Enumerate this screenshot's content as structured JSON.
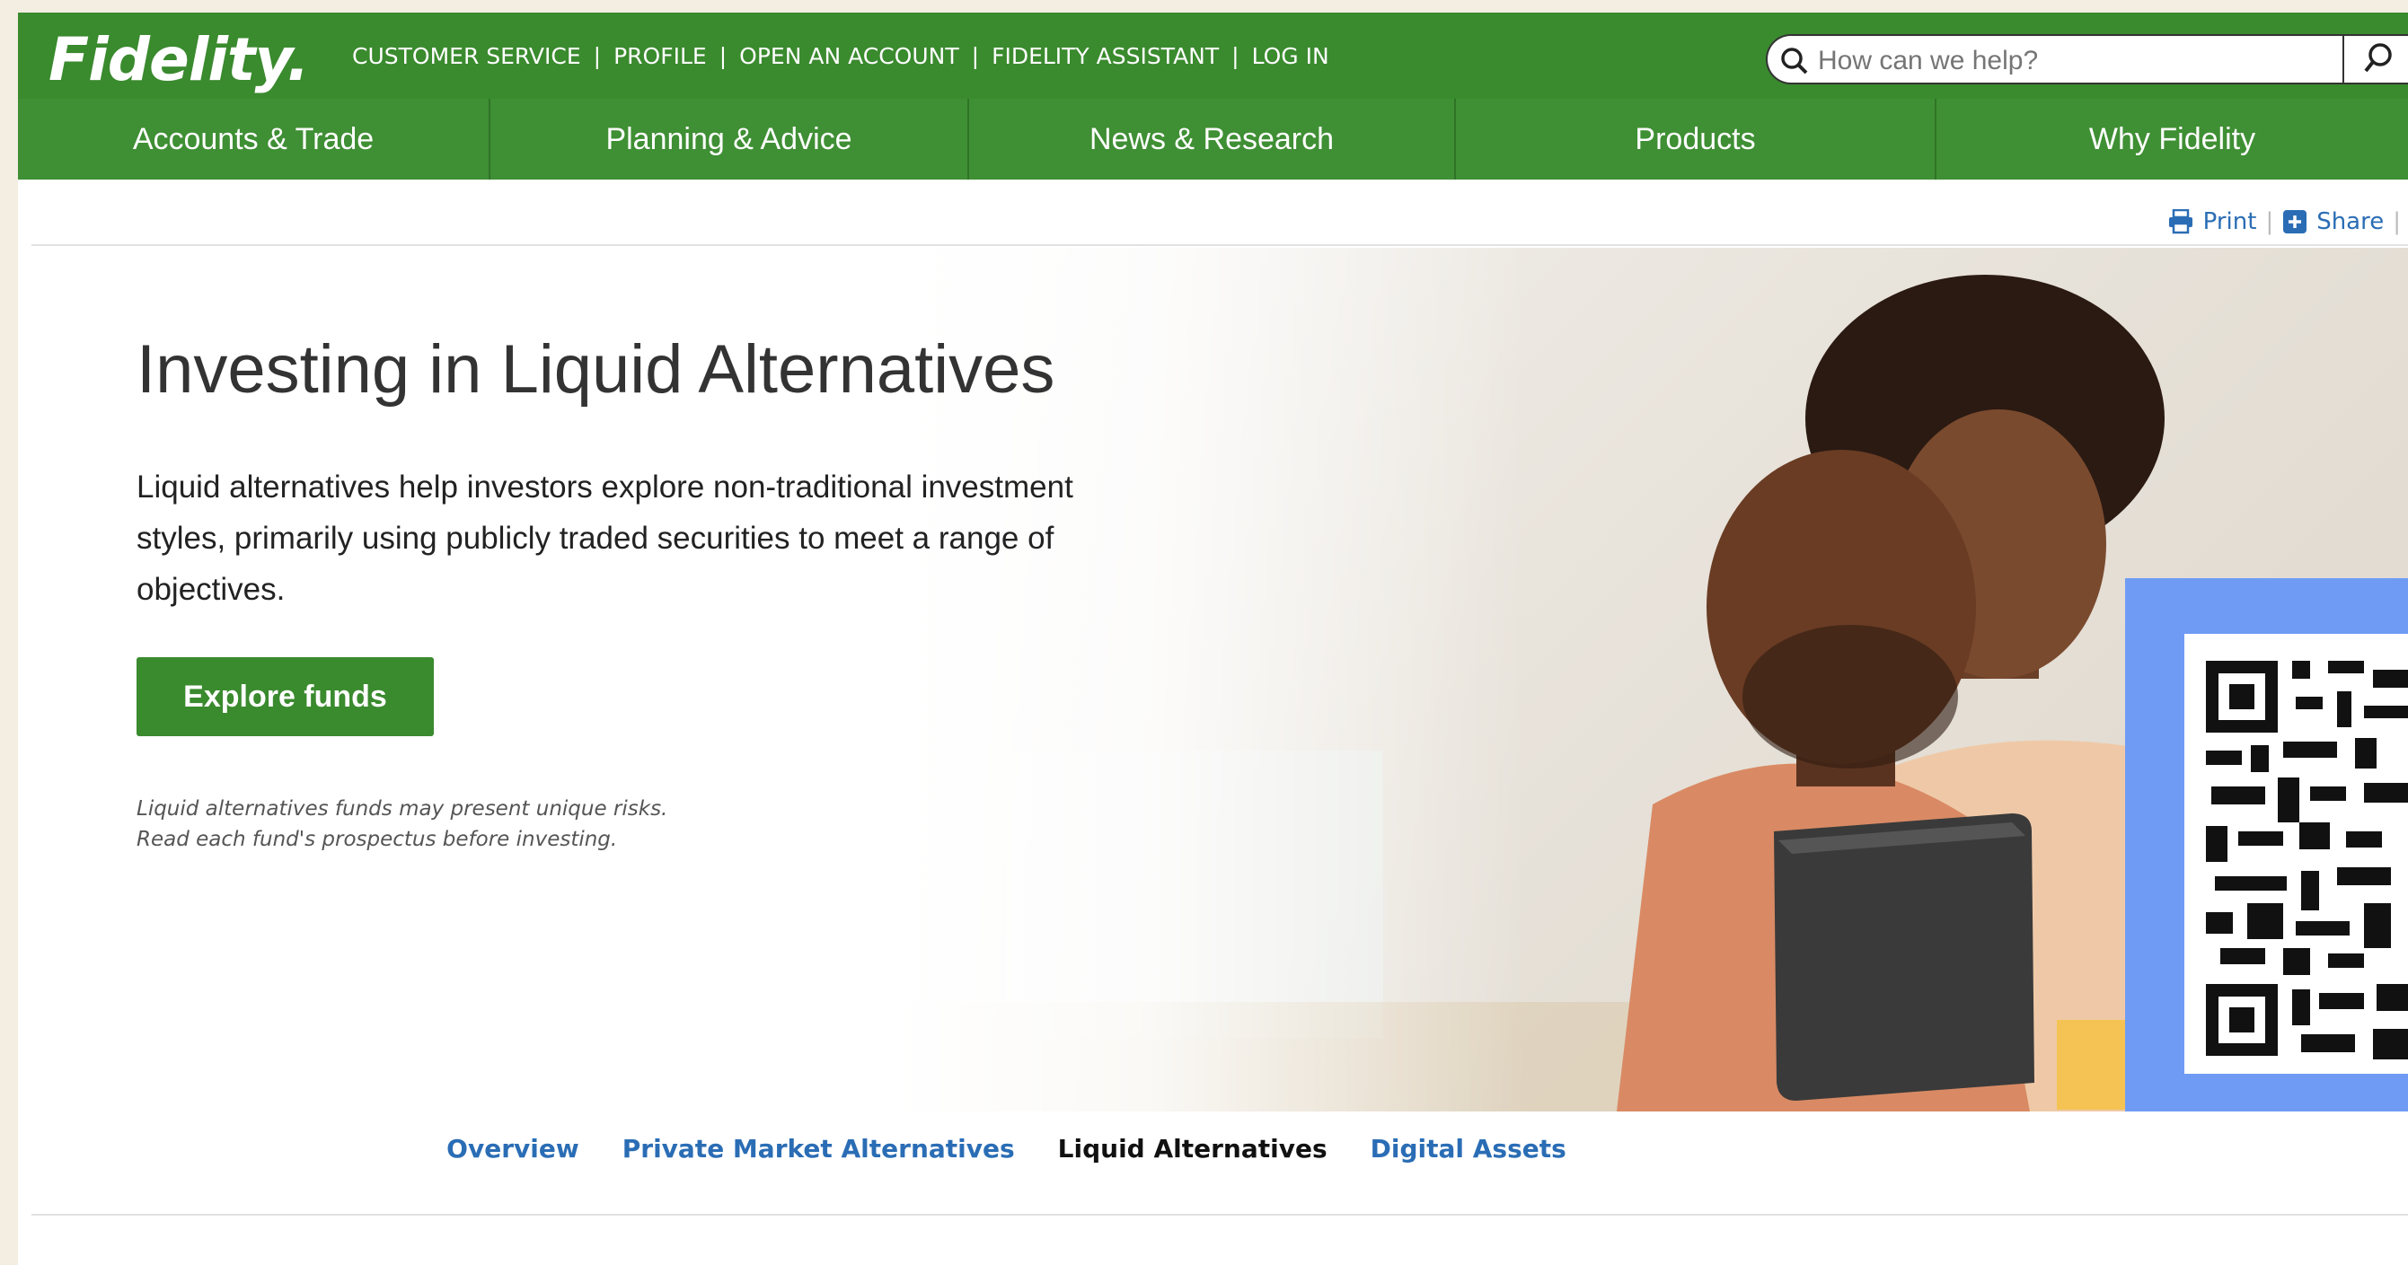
{
  "brand": {
    "logo_text": "Fidelity."
  },
  "top_links": [
    "CUSTOMER SERVICE",
    "PROFILE",
    "OPEN AN ACCOUNT",
    "FIDELITY ASSISTANT",
    "LOG IN"
  ],
  "search": {
    "placeholder": "How can we help?"
  },
  "main_nav": [
    "Accounts & Trade",
    "Planning & Advice",
    "News & Research",
    "Products",
    "Why Fidelity"
  ],
  "utility": {
    "print": "Print",
    "share": "Share"
  },
  "hero": {
    "title": "Investing in Liquid Alternatives",
    "description": "Liquid alternatives help investors explore non-traditional investment styles, primarily using publicly traded securities to meet a range of objectives.",
    "cta": "Explore funds",
    "disclaimer_line1": "Liquid alternatives funds may present unique risks.",
    "disclaimer_line2": "Read each fund's prospectus before investing."
  },
  "sub_nav": {
    "items": [
      "Overview",
      "Private Market Alternatives",
      "Liquid Alternatives",
      "Digital Assets"
    ],
    "active": "Liquid Alternatives"
  },
  "colors": {
    "brand_green": "#3a8a2e",
    "link_blue": "#2a6db5",
    "qr_panel_blue": "#6f9bf5",
    "outer_background": "#f3eee1"
  }
}
